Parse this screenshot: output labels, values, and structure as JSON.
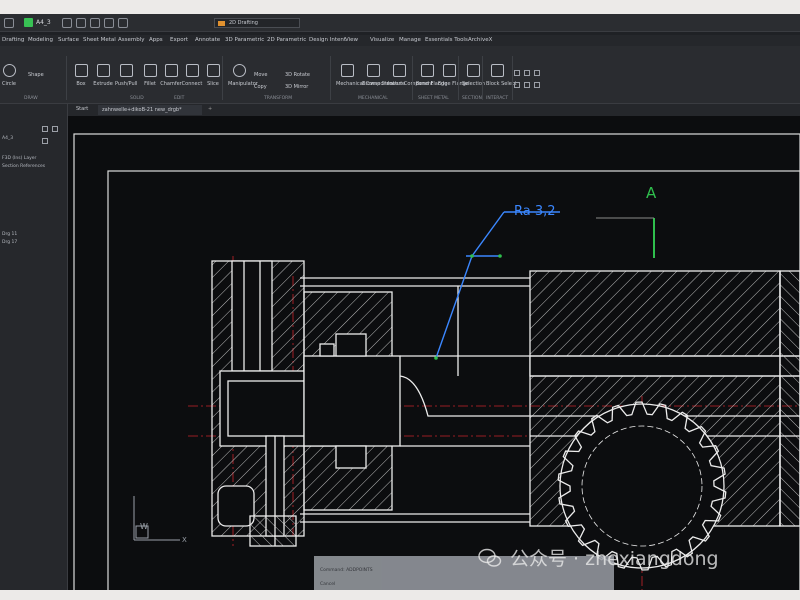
{
  "titlebar": {
    "document_name": "A4_3",
    "workspace": "2D Drafting"
  },
  "menu": {
    "tabs": [
      "Drafting",
      "Modeling",
      "Surface",
      "Sheet Metal",
      "Assembly",
      "Apps",
      "Export",
      "Annotate",
      "3D Parametric",
      "2D Parametric",
      "Design Intent",
      "View",
      "Visualize",
      "Manage",
      "Essentials Tools",
      "ArchiveX"
    ]
  },
  "ribbon": {
    "tools": [
      "Circle",
      "Box",
      "Extrude",
      "Push/Pull",
      "Fillet",
      "Chamfer",
      "Connect",
      "Slice",
      "Manipulator",
      "Mechanical Component",
      "Browse Structure",
      "Insert Component",
      "Bend Flange",
      "Edge Flange",
      "Selection",
      "Block Select"
    ],
    "small_tools": [
      "Shape",
      "Move",
      "Copy",
      "3D Rotate",
      "3D Mirror"
    ],
    "groups": [
      "DRAW",
      "SOLID",
      "EDIT",
      "TRANSFORM",
      "MECHANICAL",
      "SHEET METAL",
      "SECTION",
      "INTERACT"
    ]
  },
  "document_tabs": {
    "start": "Start",
    "drawing": "zahnwelle+dikoB-21 new_drgb*"
  },
  "left_panel": {
    "items": [
      "A4_3",
      "F3D (Ins) Layer",
      "Section References",
      "Drg 11",
      "Drg 17"
    ]
  },
  "drawing": {
    "surface_symbol": "Ra 3,2",
    "datum_label": "A",
    "axis_w": "W",
    "axis_x": "X"
  },
  "status": {
    "lines": [
      "Command: ADDPOINTS",
      "Cancel"
    ]
  },
  "watermark": {
    "text": "公众号 · zhexiangdong"
  },
  "colors": {
    "canvas": "#0c0d0f",
    "dimension_blue": "#3b87ff",
    "datum_green": "#2fbf4d",
    "centerline_red": "#c8232b",
    "geometry": "#e9e9e9"
  }
}
